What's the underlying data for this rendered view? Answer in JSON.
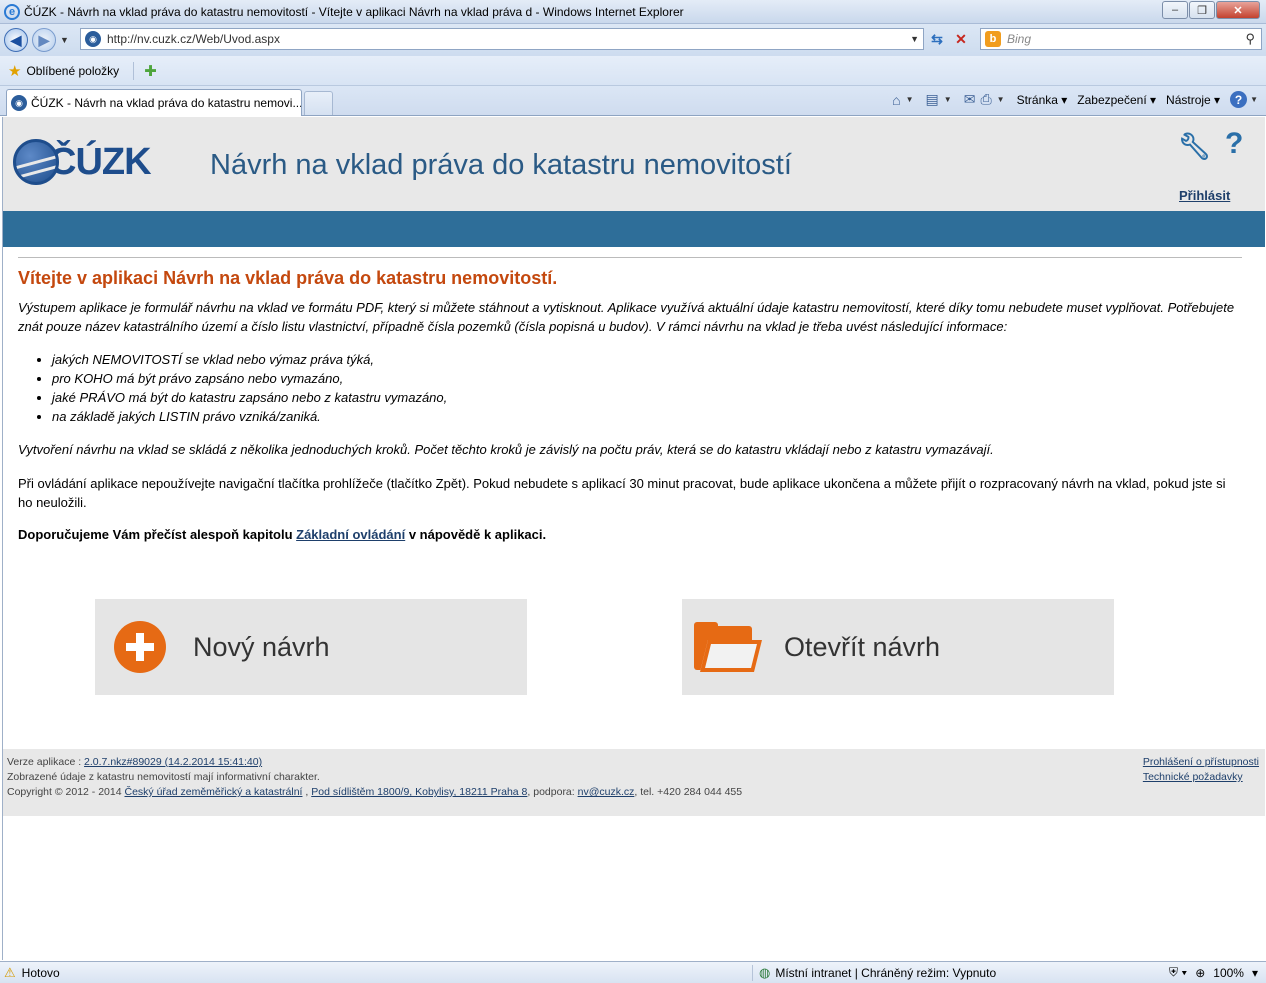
{
  "browser": {
    "window_title": "ČÚZK - Návrh na vklad práva do katastru nemovitostí - Vítejte v aplikaci Návrh na vklad práva d - Windows Internet Explorer",
    "url": "http://nv.cuzk.cz/Web/Uvod.aspx",
    "search_placeholder": "Bing",
    "favorites_label": "Oblíbené položky",
    "tab_title": "ČÚZK - Návrh na vklad práva do katastru nemovi...",
    "menu_page": "Stránka",
    "menu_security": "Zabezpečení",
    "menu_tools": "Nástroje",
    "status_text": "Hotovo",
    "zone_text": "Místní intranet | Chráněný režim: Vypnuto",
    "zoom": "100%"
  },
  "header": {
    "logo_text": "ČÚZK",
    "app_title": "Návrh na vklad práva do katastru nemovitostí",
    "login_label": "Přihlásit"
  },
  "main": {
    "welcome_title": "Vítejte v aplikaci Návrh na vklad práva do katastru nemovitostí.",
    "intro": "Výstupem aplikace je formulář návrhu na vklad ve formátu PDF, který si můžete stáhnout a vytisknout. Aplikace využívá aktuální údaje katastru nemovitostí, které díky tomu nebudete muset vyplňovat. Potřebujete znát pouze název katastrálního území a číslo listu vlastnictví, případně čísla pozemků (čísla popisná u budov). V rámci návrhu na vklad je třeba uvést následující informace:",
    "bullets": [
      "jakých NEMOVITOSTÍ se vklad nebo výmaz práva týká,",
      "pro KOHO má být právo zapsáno nebo vymazáno,",
      "jaké PRÁVO má být do katastru zapsáno nebo z katastru vymazáno,",
      "na základě jakých LISTIN právo vzniká/zaniká."
    ],
    "steps": "Vytvoření návrhu na vklad se skládá z několika jednoduchých kroků. Počet těchto kroků je závislý na počtu práv, která se do katastru vkládají nebo z katastru vymazávají.",
    "warning": "Při ovládání aplikace nepoužívejte navigační tlačítka prohlížeče (tlačítko Zpět). Pokud nebudete s aplikací 30 minut pracovat, bude aplikace ukončena a můžete přijít o rozpracovaný návrh na vklad, pokud jste si ho neuložili.",
    "recommend_prefix": "Doporučujeme Vám přečíst alespoň kapitolu ",
    "recommend_link": "Základní ovládání",
    "recommend_suffix": " v nápovědě k aplikaci.",
    "new_button": "Nový návrh",
    "open_button": "Otevřít návrh"
  },
  "footer": {
    "version_prefix": "Verze aplikace : ",
    "version_link": "2.0.7.nkz#89029 (14.2.2014 15:41:40)",
    "info": "Zobrazené údaje z katastru nemovitostí mají informativní charakter.",
    "copyright_prefix": "Copyright © 2012 - 2014 ",
    "office_link": "Český úřad zeměměřický a katastrální",
    "comma": " , ",
    "address_link": "Pod sídlištěm 1800/9, Kobylisy, 18211 Praha 8",
    "support_prefix": ", podpora: ",
    "email_link": "nv@cuzk.cz",
    "phone": ", tel. +420 284 044 455",
    "accessibility_link": "Prohlášení o přístupnosti",
    "requirements_link": "Technické požadavky"
  }
}
